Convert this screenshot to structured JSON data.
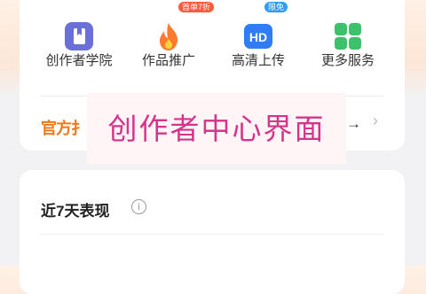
{
  "services": [
    {
      "label": "创作者学院",
      "icon": "book-icon"
    },
    {
      "label": "作品推广",
      "icon": "flame-icon",
      "badge": "首单7折"
    },
    {
      "label": "高清上传",
      "icon": "hd-icon",
      "badge": "限免",
      "icon_text": "HD"
    },
    {
      "label": "更多服务",
      "icon": "grid-icon"
    }
  ],
  "banner": {
    "left_text": "官方扌",
    "arrow": "→",
    "chevron": "›"
  },
  "overlay": {
    "text": "创作者中心界面"
  },
  "stats": {
    "title": "近7天表现",
    "info": "i"
  },
  "colors": {
    "purple": "#6b6fd9",
    "orange": "#ff7a2e",
    "blue": "#2f7cf6",
    "green": "#3ec16c",
    "magenta": "#d6338a"
  }
}
